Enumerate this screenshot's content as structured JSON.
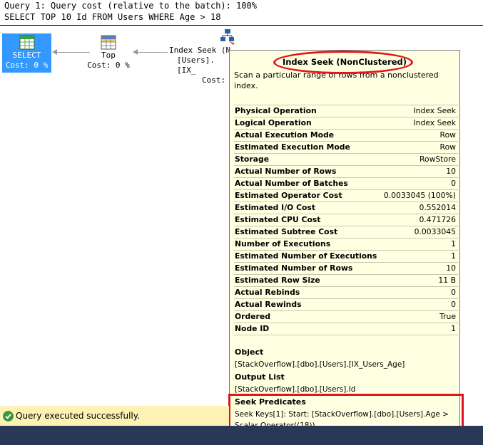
{
  "query": {
    "cost_line": "Query 1: Query cost (relative to the batch): 100%",
    "sql": "SELECT TOP 10 Id FROM Users WHERE Age > 18"
  },
  "plan": {
    "select_node": {
      "label": "SELECT",
      "cost": "Cost: 0 %"
    },
    "top_node": {
      "label": "Top",
      "cost": "Cost: 0 %"
    },
    "seek_node": {
      "line1": "Index Seek (N",
      "line2": "[Users].[IX_",
      "line3": "Cost:"
    }
  },
  "tooltip": {
    "title": "Index Seek (NonClustered)",
    "description": "Scan a particular range of rows from a nonclustered index.",
    "properties": [
      {
        "name": "Physical Operation",
        "value": "Index Seek"
      },
      {
        "name": "Logical Operation",
        "value": "Index Seek"
      },
      {
        "name": "Actual Execution Mode",
        "value": "Row"
      },
      {
        "name": "Estimated Execution Mode",
        "value": "Row"
      },
      {
        "name": "Storage",
        "value": "RowStore"
      },
      {
        "name": "Actual Number of Rows",
        "value": "10"
      },
      {
        "name": "Actual Number of Batches",
        "value": "0"
      },
      {
        "name": "Estimated Operator Cost",
        "value": "0.0033045 (100%)"
      },
      {
        "name": "Estimated I/O Cost",
        "value": "0.552014"
      },
      {
        "name": "Estimated CPU Cost",
        "value": "0.471726"
      },
      {
        "name": "Estimated Subtree Cost",
        "value": "0.0033045"
      },
      {
        "name": "Number of Executions",
        "value": "1"
      },
      {
        "name": "Estimated Number of Executions",
        "value": "1"
      },
      {
        "name": "Estimated Number of Rows",
        "value": "10"
      },
      {
        "name": "Estimated Row Size",
        "value": "11 B"
      },
      {
        "name": "Actual Rebinds",
        "value": "0"
      },
      {
        "name": "Actual Rewinds",
        "value": "0"
      },
      {
        "name": "Ordered",
        "value": "True"
      },
      {
        "name": "Node ID",
        "value": "1"
      }
    ],
    "object_label": "Object",
    "object_value": "[StackOverflow].[dbo].[Users].[IX_Users_Age]",
    "output_label": "Output List",
    "output_value": "[StackOverflow].[dbo].[Users].Id",
    "seek_label": "Seek Predicates",
    "seek_value": "Seek Keys[1]: Start: [StackOverflow].[dbo].[Users].Age > Scalar Operator((18))"
  },
  "status": {
    "text": "Query executed successfully.",
    "icon": "check-circle-icon",
    "ok_color": "#3c9b3c"
  },
  "colors": {
    "tooltip_bg": "#ffffe1",
    "highlight_red": "#e3141b",
    "selected_node": "#3399ff",
    "status_bg": "#fdf2b3",
    "bottom_bar": "#293955"
  }
}
